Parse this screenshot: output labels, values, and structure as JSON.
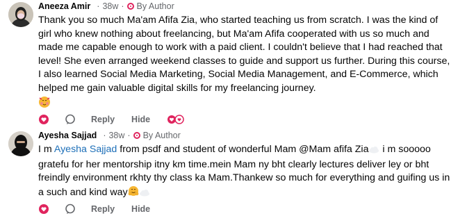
{
  "comments": [
    {
      "author": "Aneeza Amir",
      "age": "38w",
      "badge": "By Author",
      "text": "Thank you so much Ma'am Afifa Zia, who started teaching us from scratch. I was the kind of girl who knew nothing about freelancing, but Ma'am Afifa cooperated with us so much and made me capable enough to work with a paid client. I couldn't believe that I had reached that level! She even arranged weekend classes to guide and support us further. During this course, I also learned Social Media Marketing, Social Media Management, and E-Commerce, which helped me gain valuable digital skills for my freelancing journey.",
      "reply_label": "Reply",
      "hide_label": "Hide"
    },
    {
      "author": "Ayesha Sajjad",
      "age": "38w",
      "badge": "By Author",
      "text_before": "I m ",
      "mention": "Ayesha Sajjad",
      "text_after": " from psdf and student of wonderful Mam @Mam afifa Zia",
      "text_line2": " i m sooooo gratefu for her mentorship itny km time.mein Mam ny bht clearly lectures deliver ley or bht freindly environment rkhty thy class ka Mam.Thankew so much for everything and guifing us in a such and kind way",
      "reply_label": "Reply",
      "hide_label": "Hide"
    }
  ],
  "icons": {
    "like": "heart-outline-icon",
    "comment": "speech-bubble-icon",
    "reactions": [
      "heart-reaction-icon",
      "love-reaction-icon"
    ]
  },
  "colors": {
    "accent": "#e0245e",
    "mention": "#1d6fb8",
    "muted": "#65676b"
  }
}
